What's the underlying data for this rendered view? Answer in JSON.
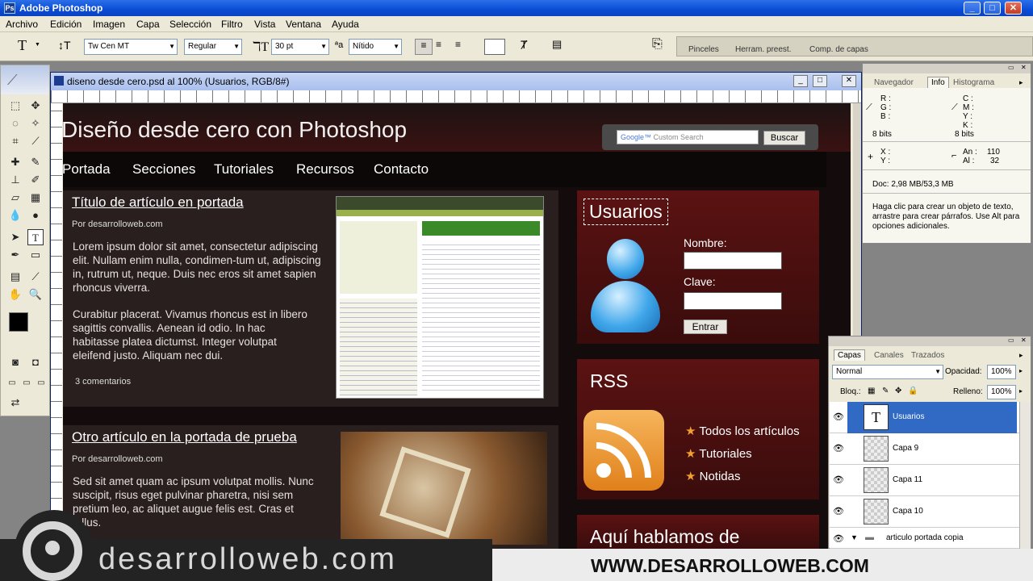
{
  "app": {
    "title": "Adobe Photoshop"
  },
  "menu": [
    "Archivo",
    "Edición",
    "Imagen",
    "Capa",
    "Selección",
    "Filtro",
    "Vista",
    "Ventana",
    "Ayuda"
  ],
  "options": {
    "font_family": "Tw Cen MT",
    "font_style": "Regular",
    "font_size": "30 pt",
    "antialias": "Nítido",
    "wells": [
      "Pinceles",
      "Herram. preest.",
      "Comp. de capas"
    ]
  },
  "document": {
    "title": "diseno desde cero.psd al 100% (Usuarios, RGB/8#)"
  },
  "site": {
    "title": "Diseño desde cero con Photoshop",
    "search_placeholder": "Custom Search",
    "search_button": "Buscar",
    "nav": [
      "Portada",
      "Secciones",
      "Tutoriales",
      "Recursos",
      "Contacto"
    ],
    "article1": {
      "title": "Título de artículo en portada",
      "byline": "Por desarrolloweb.com",
      "p1": "Lorem ipsum dolor sit amet, consectetur adipiscing elit. Nullam enim nulla, condimen-tum ut, adipiscing in, rutrum ut, neque. Duis nec eros sit amet sapien rhoncus viverra.",
      "p2": "Curabitur placerat. Vivamus rhoncus est in libero sagittis convallis. Aenean id odio. In hac habitasse platea dictumst. Integer volutpat eleifend justo. Aliquam nec dui.",
      "comments": "3 comentarios"
    },
    "article2": {
      "title": "Otro artículo en la portada de prueba",
      "byline": "Por desarrolloweb.com",
      "p1": "Sed sit amet quam ac ipsum volutpat mollis. Nunc suscipit, risus eget pulvinar pharetra, nisi sem pretium leo, ac aliquet augue felis est. Cras et tellus."
    },
    "login": {
      "heading": "Usuarios",
      "name_label": "Nombre:",
      "key_label": "Clave:",
      "button": "Entrar"
    },
    "rss": {
      "heading": "RSS",
      "links": [
        "Todos los artículos",
        "Tutoriales",
        "Notidas"
      ]
    },
    "third_heading": "Aquí hablamos de"
  },
  "info_panel": {
    "tabs": [
      "Navegador",
      "Info",
      "Histograma"
    ],
    "r": "R :",
    "g": "G :",
    "b": "B :",
    "bits1": "8 bits",
    "c": "C :",
    "m": "M :",
    "y": "Y :",
    "k": "K :",
    "bits2": "8 bits",
    "x": "X :",
    "yy": "Y :",
    "an_label": "An :",
    "an": "110",
    "al_label": "Al :",
    "al": "32",
    "doc": "Doc: 2,98 MB/53,3 MB",
    "help": "Haga clic para crear un objeto de texto, arrastre para crear párrafos. Use Alt para opciones adicionales."
  },
  "layers_panel": {
    "tabs": [
      "Capas",
      "Canales",
      "Trazados"
    ],
    "blend_mode": "Normal",
    "opacity_label": "Opacidad:",
    "opacity": "100%",
    "lock_label": "Bloq.:",
    "fill_label": "Relleno:",
    "fill": "100%",
    "layers": [
      "Usuarios",
      "Capa 9",
      "Capa 11",
      "Capa 10"
    ],
    "group": "articulo portada copia"
  },
  "watermark": {
    "left": "desarrolloweb.com",
    "right": "WWW.DESARROLLOWEB.COM"
  }
}
